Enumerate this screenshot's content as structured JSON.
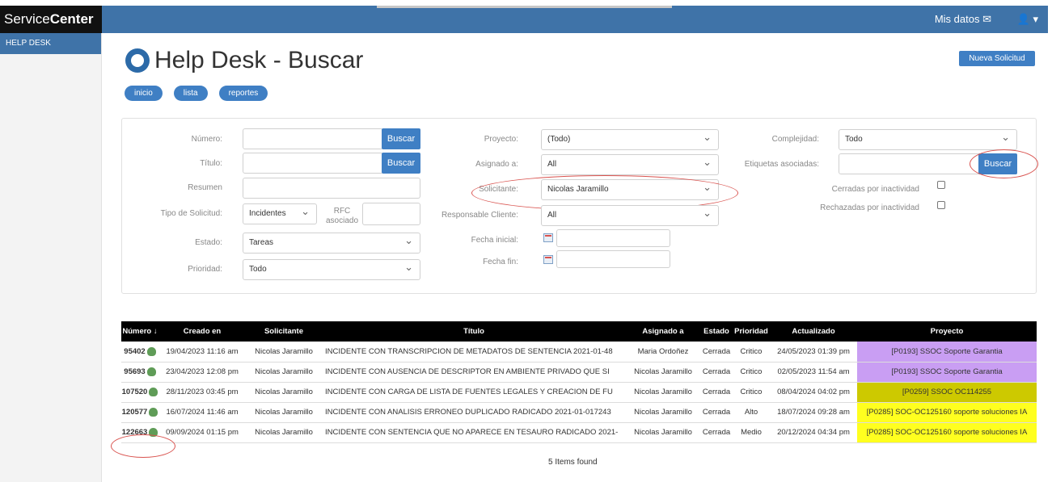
{
  "brand": {
    "prefix": "Service",
    "bold": "Center"
  },
  "topbar": {
    "mis_datos": "Mis datos",
    "mail_icon": "envelope-icon",
    "user_icon": "user-icon"
  },
  "sidebar": {
    "items": [
      {
        "label": "HELP DESK"
      }
    ]
  },
  "page": {
    "title": "Help Desk - Buscar",
    "new_button": "Nueva Solicitud"
  },
  "pills": [
    {
      "label": "inicio"
    },
    {
      "label": "lista"
    },
    {
      "label": "reportes"
    }
  ],
  "form": {
    "numero_label": "Número:",
    "titulo_label": "Título:",
    "resumen_label": "Resumen",
    "tipo_label": "Tipo de Solicitud:",
    "tipo_value": "Incidentes",
    "rfc_label_1": "RFC",
    "rfc_label_2": "asociado",
    "estado_label": "Estado:",
    "estado_value": "Tareas",
    "prioridad_label": "Prioridad:",
    "prioridad_value": "Todo",
    "buscar": "Buscar",
    "proyecto_label": "Proyecto:",
    "proyecto_value": "(Todo)",
    "asignado_label": "Asignado a:",
    "asignado_value": "All",
    "solicitante_label": "Solicitante:",
    "solicitante_value": "Nicolas Jaramillo",
    "responsable_label": "Responsable Cliente:",
    "responsable_value": "All",
    "fecha_inicial_label": "Fecha inicial:",
    "fecha_fin_label": "Fecha fin:",
    "complejidad_label": "Complejidad:",
    "complejidad_value": "Todo",
    "etiquetas_label": "Etiquetas asociadas:",
    "cerradas_label": "Cerradas por inactividad",
    "rechazadas_label": "Rechazadas por inactividad"
  },
  "table": {
    "headers": [
      "Número ↓",
      "Creado en",
      "Solicitante",
      "Título",
      "Asignado a",
      "Estado",
      "Prioridad",
      "Actualizado",
      "Proyecto"
    ],
    "rows": [
      {
        "numero": "95402",
        "creado": "19/04/2023 11:16 am",
        "solicitante": "Nicolas Jaramillo",
        "titulo": "INCIDENTE CON TRANSCRIPCION DE METADATOS DE SENTENCIA 2021-01-48",
        "asignado": "Maria Ordoñez",
        "estado": "Cerrada",
        "prioridad": "Critico",
        "actualizado": "24/05/2023 01:39 pm",
        "proyecto": "[P0193] SSOC Soporte Garantia",
        "color": "#c99ef3"
      },
      {
        "numero": "95693",
        "creado": "23/04/2023 12:08 pm",
        "solicitante": "Nicolas Jaramillo",
        "titulo": "INCIDENTE CON AUSENCIA DE DESCRIPTOR EN AMBIENTE PRIVADO QUE SI",
        "asignado": "Nicolas Jaramillo",
        "estado": "Cerrada",
        "prioridad": "Critico",
        "actualizado": "02/05/2023 11:54 am",
        "proyecto": "[P0193] SSOC Soporte Garantia",
        "color": "#c99ef3"
      },
      {
        "numero": "107520",
        "creado": "28/11/2023 03:45 pm",
        "solicitante": "Nicolas Jaramillo",
        "titulo": "INCIDENTE CON CARGA DE LISTA DE FUENTES LEGALES Y CREACION DE FU",
        "asignado": "Nicolas Jaramillo",
        "estado": "Cerrada",
        "prioridad": "Critico",
        "actualizado": "08/04/2024 04:02 pm",
        "proyecto": "[P0259] SSOC OC114255",
        "color": "#cdc900"
      },
      {
        "numero": "120577",
        "creado": "16/07/2024 11:46 am",
        "solicitante": "Nicolas Jaramillo",
        "titulo": "INCIDENTE CON ANALISIS ERRONEO DUPLICADO RADICADO 2021-01-017243",
        "asignado": "Nicolas Jaramillo",
        "estado": "Cerrada",
        "prioridad": "Alto",
        "actualizado": "18/07/2024 09:28 am",
        "proyecto": "[P0285] SOC-OC125160 soporte soluciones IA",
        "color": "#ffff1f"
      },
      {
        "numero": "122663",
        "creado": "09/09/2024 01:15 pm",
        "solicitante": "Nicolas Jaramillo",
        "titulo": "INCIDENTE CON SENTENCIA QUE NO APARECE EN TESAURO RADICADO 2021-",
        "asignado": "Nicolas Jaramillo",
        "estado": "Cerrada",
        "prioridad": "Medio",
        "actualizado": "20/12/2024 04:34 pm",
        "proyecto": "[P0285] SOC-OC125160 soporte soluciones IA",
        "color": "#ffff1f"
      }
    ],
    "footer": "5 Items found"
  }
}
